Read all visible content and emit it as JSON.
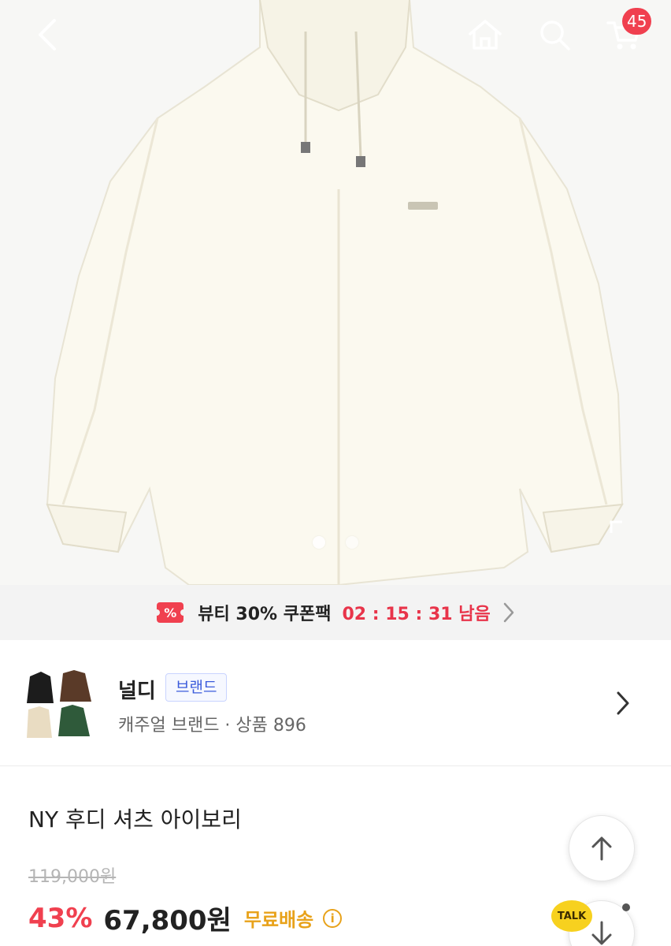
{
  "header": {
    "back_icon": "chevron-left-icon",
    "home_icon": "home-icon",
    "search_icon": "search-icon",
    "cart_icon": "cart-icon",
    "cart_count": "45"
  },
  "gallery": {
    "slide_count": 2,
    "active_slide": 1
  },
  "coupon_banner": {
    "icon": "coupon-icon",
    "label": "뷰티 30% 쿠폰팩",
    "timer": "02 : 15 : 31 남음"
  },
  "brand": {
    "name": "널디",
    "tag": "브랜드",
    "subtitle": "캐주얼 브랜드 · 상품 896"
  },
  "product": {
    "title": "NY 후디 셔츠 아이보리",
    "original_price": "119,000원",
    "discount": "43%",
    "price": "67,800원",
    "shipping": "무료배송",
    "info_icon_glyph": "i"
  },
  "floating": {
    "scroll_up_icon": "arrow-up-icon",
    "scroll_down_icon": "arrow-down-icon",
    "talk_label": "TALK"
  },
  "colors": {
    "accent_red": "#f0404f",
    "shipping_orange": "#e8a21a",
    "brand_tag_blue": "#3b5bdb",
    "talk_yellow": "#f7d11f"
  }
}
